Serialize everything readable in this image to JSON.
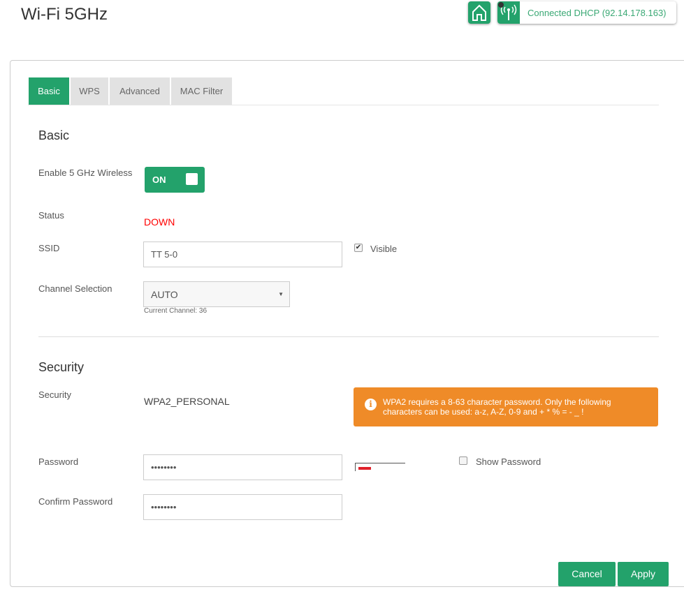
{
  "header": {
    "title": "Wi-Fi 5GHz",
    "connection_status": "Connected DHCP (92.14.178.163)"
  },
  "tabs": [
    {
      "label": "Basic",
      "active": true
    },
    {
      "label": "WPS"
    },
    {
      "label": "Advanced"
    },
    {
      "label": "MAC Filter"
    }
  ],
  "basic": {
    "heading": "Basic",
    "enable_label": "Enable 5 GHz Wireless",
    "enable_value": "ON",
    "status_label": "Status",
    "status_value": "DOWN",
    "ssid_label": "SSID",
    "ssid_value": "TT 5-0",
    "visible_label": "Visible",
    "visible_checked": true,
    "channel_label": "Channel Selection",
    "channel_value": "AUTO",
    "current_channel": "Current Channel: 36"
  },
  "security": {
    "heading": "Security",
    "security_label": "Security",
    "security_value": "WPA2_PERSONAL",
    "warning": "WPA2 requires a 8-63 character password. Only the following characters can be used: a-z, A-Z, 0-9 and + * % = - _ !",
    "password_label": "Password",
    "password_value": "••••••••",
    "password_strength": 0.25,
    "show_password_label": "Show Password",
    "show_password_checked": false,
    "confirm_label": "Confirm Password",
    "confirm_value": "••••••••"
  },
  "buttons": {
    "cancel": "Cancel",
    "apply": "Apply"
  },
  "colors": {
    "accent": "#23a26b",
    "warning": "#ef8b28",
    "error": "#ff0000"
  }
}
